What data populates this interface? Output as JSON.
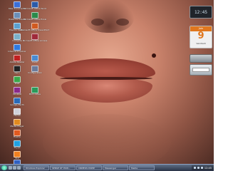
{
  "desktop": {
    "icons": [
      {
        "label": "Mes documents",
        "icon": "folder-icon"
      },
      {
        "label": "Poste de travail",
        "icon": "computer-icon"
      },
      {
        "label": "Favoris réseau",
        "icon": "network-icon"
      },
      {
        "label": "Corbeille",
        "icon": "recycle-bin-icon"
      },
      {
        "label": "Internet Explorer",
        "icon": "ie-icon"
      },
      {
        "label": "Adobe Reader",
        "icon": "pdf-icon"
      },
      {
        "label": "Nero",
        "icon": "disc-icon"
      },
      {
        "label": "MSN",
        "icon": "chat-icon"
      },
      {
        "label": "WinRAR",
        "icon": "archive-icon"
      },
      {
        "label": "Google Earth",
        "icon": "globe-icon"
      },
      {
        "label": "iTunes",
        "icon": "music-icon"
      },
      {
        "label": "Media Player",
        "icon": "media-icon"
      },
      {
        "label": "Firefox",
        "icon": "browser-icon"
      },
      {
        "label": "Skype",
        "icon": "phone-icon"
      },
      {
        "label": "VLC",
        "icon": "video-icon"
      },
      {
        "label": "Outlook",
        "icon": "mail-icon"
      }
    ],
    "icons_col2": [
      {
        "label": "Microsoft Office Word",
        "icon": "word-icon"
      },
      {
        "label": "Microsoft Office Excel",
        "icon": "excel-icon"
      },
      {
        "label": "Microsoft Office PowerPoint",
        "icon": "powerpoint-icon"
      },
      {
        "label": "Microsoft Office Access",
        "icon": "access-icon"
      },
      {
        "label": "Paint",
        "icon": "paint-icon"
      },
      {
        "label": "Configuration",
        "icon": "settings-icon"
      },
      {
        "label": "Bloc-notes",
        "icon": "notepad-icon"
      }
    ]
  },
  "gadgets": {
    "clock_time": "12:45",
    "calendar_header": "Juin",
    "calendar_day": "9",
    "calendar_footer": "Vendredi"
  },
  "taskbar": {
    "tasks": [
      "Windows Explorer",
      "SENSE OF POW...",
      "CNMEOS DSEIE",
      "Messenger",
      "Media"
    ],
    "clock": "12:45"
  }
}
